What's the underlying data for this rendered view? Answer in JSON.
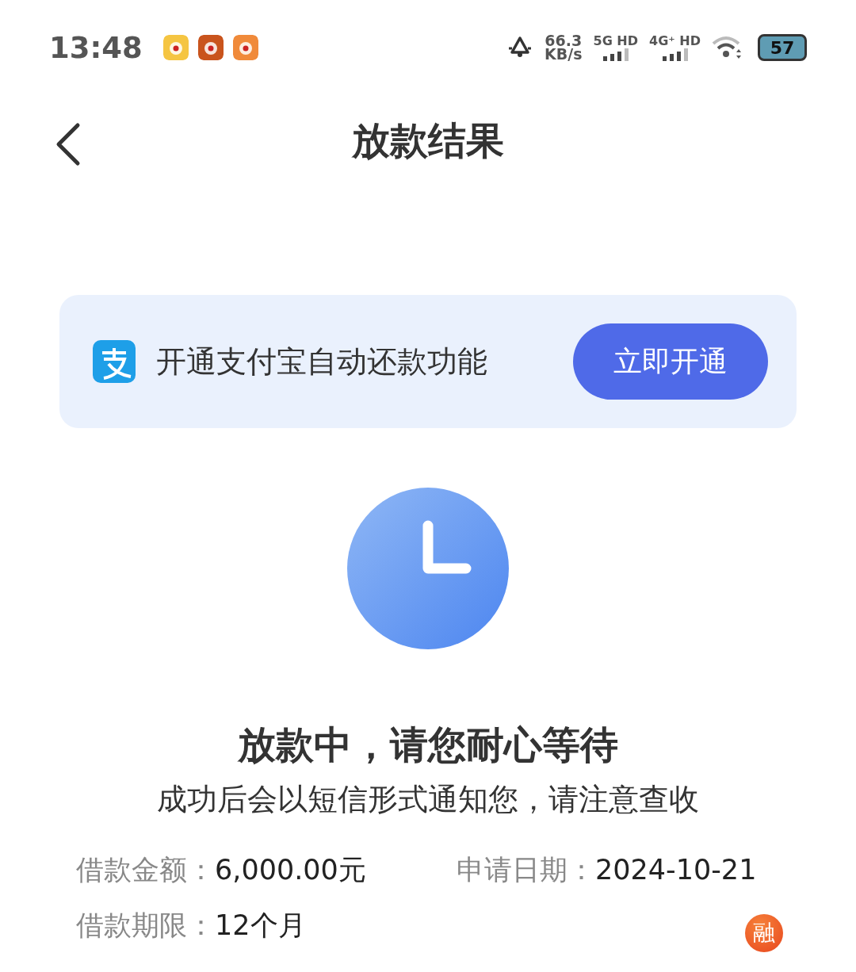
{
  "status_bar": {
    "time": "13:48",
    "net_speed": "66.3",
    "net_unit": "KB/s",
    "signal_1": "5G HD",
    "signal_2": "4G⁺ HD",
    "battery": "57"
  },
  "nav": {
    "title": "放款结果"
  },
  "banner": {
    "text": "开通支付宝自动还款功能",
    "button": "立即开通"
  },
  "result": {
    "title": "放款中，请您耐心等待",
    "subtitle": "成功后会以短信形式通知您，请注意查收"
  },
  "details": [
    {
      "label": "借款金额：",
      "value": "6,000.00元"
    },
    {
      "label": "申请日期：",
      "value": "2024-10-21"
    },
    {
      "label": "借款期限：",
      "value": "12个月"
    }
  ],
  "float_badge": {
    "text": "融"
  }
}
